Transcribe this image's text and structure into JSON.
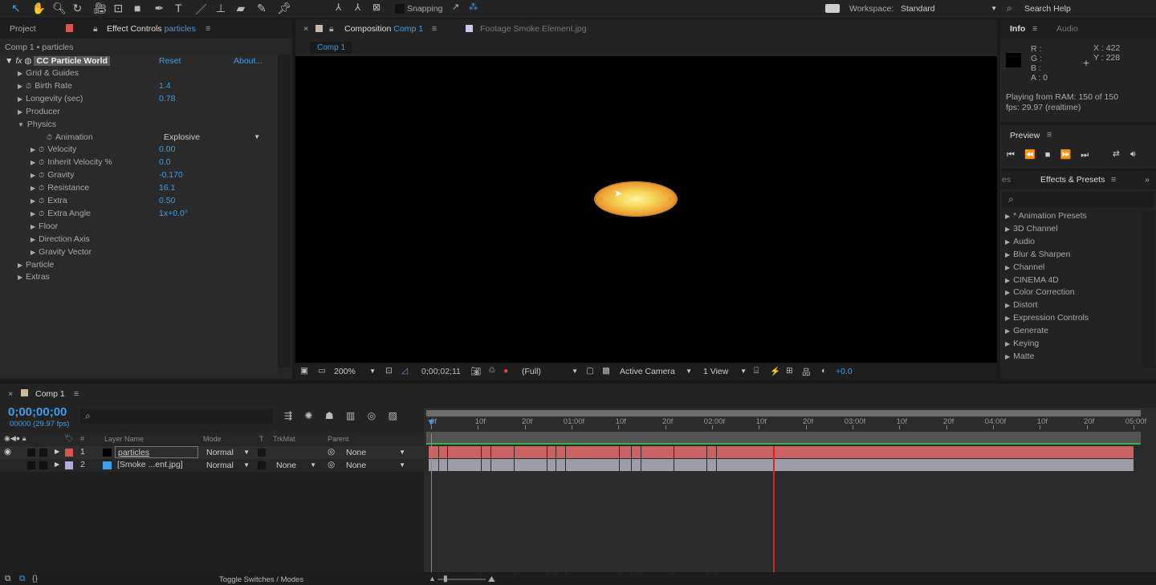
{
  "toolbar": {
    "snapping": "Snapping",
    "workspace_label": "Workspace:",
    "workspace": "Standard",
    "search_help": "Search Help",
    "tools": [
      "selection",
      "hand",
      "zoom",
      "rotate",
      "camera",
      "pan-behind",
      "rectangle",
      "pen",
      "type",
      "brush",
      "clone-stamp",
      "eraser",
      "roto-brush",
      "puppet-pin"
    ]
  },
  "left_panel": {
    "tabs": [
      "Project",
      "Effect Controls"
    ],
    "tab_target": "particles",
    "breadcrumb": "Comp 1 • particles",
    "effect": {
      "name": "CC Particle World",
      "reset": "Reset",
      "about": "About...",
      "props": [
        {
          "label": "Grid & Guides",
          "indent": 0,
          "tri": "▶"
        },
        {
          "label": "Birth Rate",
          "indent": 0,
          "tri": "▶",
          "sw": true,
          "value": "1.4"
        },
        {
          "label": "Longevity (sec)",
          "indent": 0,
          "tri": "▶",
          "value": "0.78"
        },
        {
          "label": "Producer",
          "indent": 0,
          "tri": "▶"
        },
        {
          "label": "Physics",
          "indent": 0,
          "tri": "▼"
        },
        {
          "label": "Animation",
          "indent": 2,
          "tri": "",
          "sw": true,
          "dropdown": "Explosive"
        },
        {
          "label": "Velocity",
          "indent": 1,
          "tri": "▶",
          "sw": true,
          "value": "0.00"
        },
        {
          "label": "Inherit Velocity %",
          "indent": 1,
          "tri": "▶",
          "sw": true,
          "value": "0.0"
        },
        {
          "label": "Gravity",
          "indent": 1,
          "tri": "▶",
          "sw": true,
          "value": "-0.170"
        },
        {
          "label": "Resistance",
          "indent": 1,
          "tri": "▶",
          "sw": true,
          "value": "16.1"
        },
        {
          "label": "Extra",
          "indent": 1,
          "tri": "▶",
          "sw": true,
          "value": "0.50"
        },
        {
          "label": "Extra Angle",
          "indent": 1,
          "tri": "▶",
          "sw": true,
          "value": "1x+0.0°"
        },
        {
          "label": "Floor",
          "indent": 1,
          "tri": "▶"
        },
        {
          "label": "Direction Axis",
          "indent": 1,
          "tri": "▶"
        },
        {
          "label": "Gravity Vector",
          "indent": 1,
          "tri": "▶"
        },
        {
          "label": "Particle",
          "indent": 0,
          "tri": "▶"
        },
        {
          "label": "Extras",
          "indent": 0,
          "tri": "▶"
        }
      ]
    }
  },
  "comp_panel": {
    "tab_label": "Composition",
    "tab_target": "Comp 1",
    "footage_tab": "Footage  Smoke Element.jpg",
    "subtab": "Comp 1",
    "bottom": {
      "zoom": "200%",
      "timecode": "0;00;02;11",
      "resolution": "(Full)",
      "camera": "Active Camera",
      "views": "1 View",
      "exposure": "+0.0"
    }
  },
  "info": {
    "tabs": [
      "Info",
      "Audio"
    ],
    "r": "R :",
    "g": "G :",
    "b": "B :",
    "a": "A : 0",
    "x": "X : 422",
    "y": "Y : 228",
    "status1": "Playing from RAM: 150 of 150",
    "status2": "fps: 29.97 (realtime)"
  },
  "preview": {
    "title": "Preview"
  },
  "effects_presets": {
    "partial_tab": "es",
    "title": "Effects & Presets",
    "items": [
      "* Animation Presets",
      "3D Channel",
      "Audio",
      "Blur & Sharpen",
      "Channel",
      "CINEMA 4D",
      "Color Correction",
      "Distort",
      "Expression Controls",
      "Generate",
      "Keying",
      "Matte"
    ]
  },
  "timeline": {
    "tab": "Comp 1",
    "timecode": "0;00;00;00",
    "frames": "00000 (29.97 fps)",
    "columns": {
      "name": "Layer Name",
      "mode": "Mode",
      "t": "T",
      "trkmat": "TrkMat",
      "parent": "Parent",
      "num": "#"
    },
    "layers": [
      {
        "num": "1",
        "name": "particles",
        "mode": "Normal",
        "trkmat": "",
        "parent": "None",
        "color": "#d9534f"
      },
      {
        "num": "2",
        "name": "[Smoke ...ent.jpg]",
        "mode": "Normal",
        "trkmat": "None",
        "parent": "None",
        "color": "#b0aed8"
      }
    ],
    "ruler": [
      "0f",
      "10f",
      "20f",
      "01:00f",
      "10f",
      "20f",
      "02:00f",
      "10f",
      "20f",
      "03:00f",
      "10f",
      "20f",
      "04:00f",
      "10f",
      "20f",
      "05:00f"
    ],
    "playhead_frame": 73,
    "total_frames": 150,
    "toggle": "Toggle Switches / Modes"
  },
  "colors": {
    "accent": "#3d9ee8",
    "playhead": "#e02020",
    "layer1_bar": "#c96262",
    "layer2_bar": "#9d9daa"
  }
}
